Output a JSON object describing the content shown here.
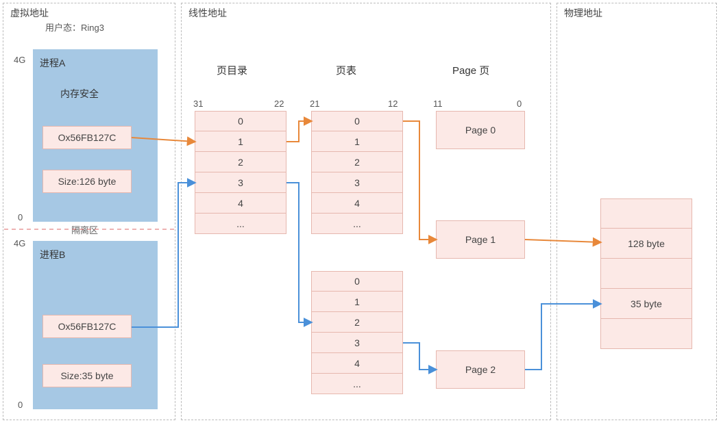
{
  "sections": {
    "virtual": {
      "title": "虚拟地址"
    },
    "linear": {
      "title": "线性地址"
    },
    "physical": {
      "title": "物理地址"
    }
  },
  "user_mode": "用户态：Ring3",
  "processA": {
    "title": "进程A",
    "subtitle": "内存安全",
    "addr": "Ox56FB127C",
    "size": "Size:126 byte",
    "top_mark": "4G",
    "bottom_mark": "0"
  },
  "isolation": "隔离区",
  "processB": {
    "title": "进程B",
    "addr": "Ox56FB127C",
    "size": "Size:35 byte",
    "top_mark": "4G",
    "bottom_mark": "0"
  },
  "page_dir": {
    "title": "页目录",
    "bit_hi": "31",
    "bit_lo": "22",
    "rows": [
      "0",
      "1",
      "2",
      "3",
      "4",
      "..."
    ]
  },
  "page_table1": {
    "title": "页表",
    "bit_hi": "21",
    "bit_lo": "12",
    "rows": [
      "0",
      "1",
      "2",
      "3",
      "4",
      "..."
    ]
  },
  "page_table2": {
    "rows": [
      "0",
      "1",
      "2",
      "3",
      "4",
      "..."
    ]
  },
  "pages": {
    "title": "Page 页",
    "bit_hi": "11",
    "bit_lo": "0",
    "p0": "Page 0",
    "p1": "Page 1",
    "p2": "Page 2"
  },
  "phys": {
    "rows": [
      "",
      "128 byte",
      "",
      "35 byte",
      ""
    ]
  }
}
